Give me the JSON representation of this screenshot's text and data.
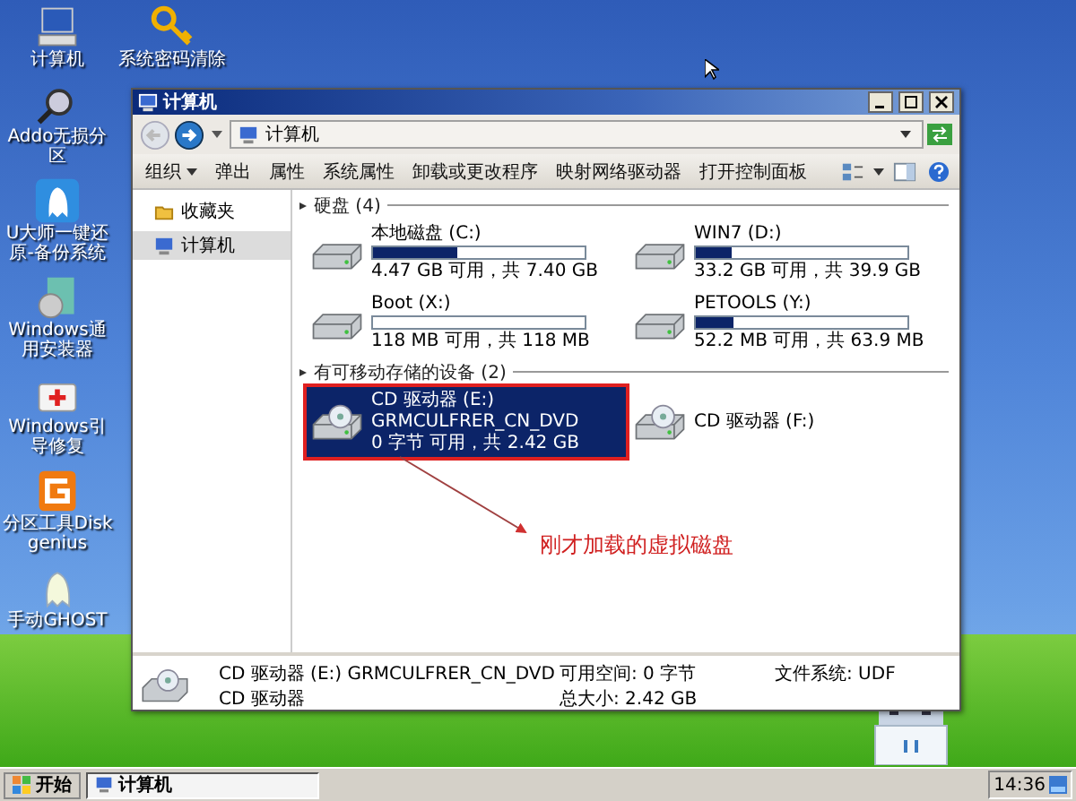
{
  "desktop_icons": [
    {
      "kind": "computer",
      "label": "计算机"
    },
    {
      "kind": "key",
      "label": "系统密码清除"
    },
    {
      "kind": "magnifier",
      "label": "Addo无损分区"
    },
    {
      "kind": "ghost",
      "label": "U大师一键还原-备份系统"
    },
    {
      "kind": "installer",
      "label": "Windows通用安装器"
    },
    {
      "kind": "firstaid",
      "label": "Windows引导修复"
    },
    {
      "kind": "partition",
      "label": "分区工具Diskgenius"
    },
    {
      "kind": "ghost2",
      "label": "手动GHOST"
    }
  ],
  "window": {
    "title": "计算机",
    "address": "计算机",
    "toolbar": [
      {
        "label": "组织",
        "dropdown": true
      },
      {
        "label": "弹出",
        "dropdown": false
      },
      {
        "label": "属性",
        "dropdown": false
      },
      {
        "label": "系统属性",
        "dropdown": false
      },
      {
        "label": "卸载或更改程序",
        "dropdown": false
      },
      {
        "label": "映射网络驱动器",
        "dropdown": false
      },
      {
        "label": "打开控制面板",
        "dropdown": false
      }
    ],
    "nav": [
      {
        "label": "收藏夹",
        "kind": "folder",
        "selected": false
      },
      {
        "label": "计算机",
        "kind": "computer",
        "selected": true
      }
    ],
    "groups": [
      {
        "title": "硬盘 (4)",
        "items": [
          {
            "kind": "hdd",
            "name": "本地磁盘 (C:)",
            "level": 0.4,
            "info": "4.47 GB 可用，共 7.40 GB",
            "selected": false
          },
          {
            "kind": "hdd",
            "name": "WIN7 (D:)",
            "level": 0.17,
            "info": "33.2 GB 可用，共 39.9 GB",
            "selected": false
          },
          {
            "kind": "hdd",
            "name": "Boot (X:)",
            "level": 0,
            "info": "118 MB 可用，共 118 MB",
            "selected": false
          },
          {
            "kind": "hdd",
            "name": "PETOOLS (Y:)",
            "level": 0.18,
            "info": "52.2 MB 可用，共 63.9 MB",
            "selected": false
          }
        ]
      },
      {
        "title": "有可移动存储的设备 (2)",
        "items": [
          {
            "kind": "cd",
            "name": "CD 驱动器 (E:)",
            "label": "GRMCULFRER_CN_DVD",
            "info": "0 字节 可用，共 2.42 GB",
            "selected": true
          },
          {
            "kind": "cd",
            "name": "CD 驱动器 (F:)",
            "selected": false
          }
        ]
      }
    ],
    "annotation": "刚才加载的虚拟磁盘",
    "details": {
      "name": "CD 驱动器 (E:) GRMCULFRER_CN_DVD",
      "type": "CD 驱动器",
      "free": "可用空间: 0 字节",
      "total": "总大小: 2.42 GB",
      "fs": "文件系统: UDF"
    }
  },
  "taskbar": {
    "start": "开始",
    "task": "计算机",
    "clock": "14:36"
  }
}
